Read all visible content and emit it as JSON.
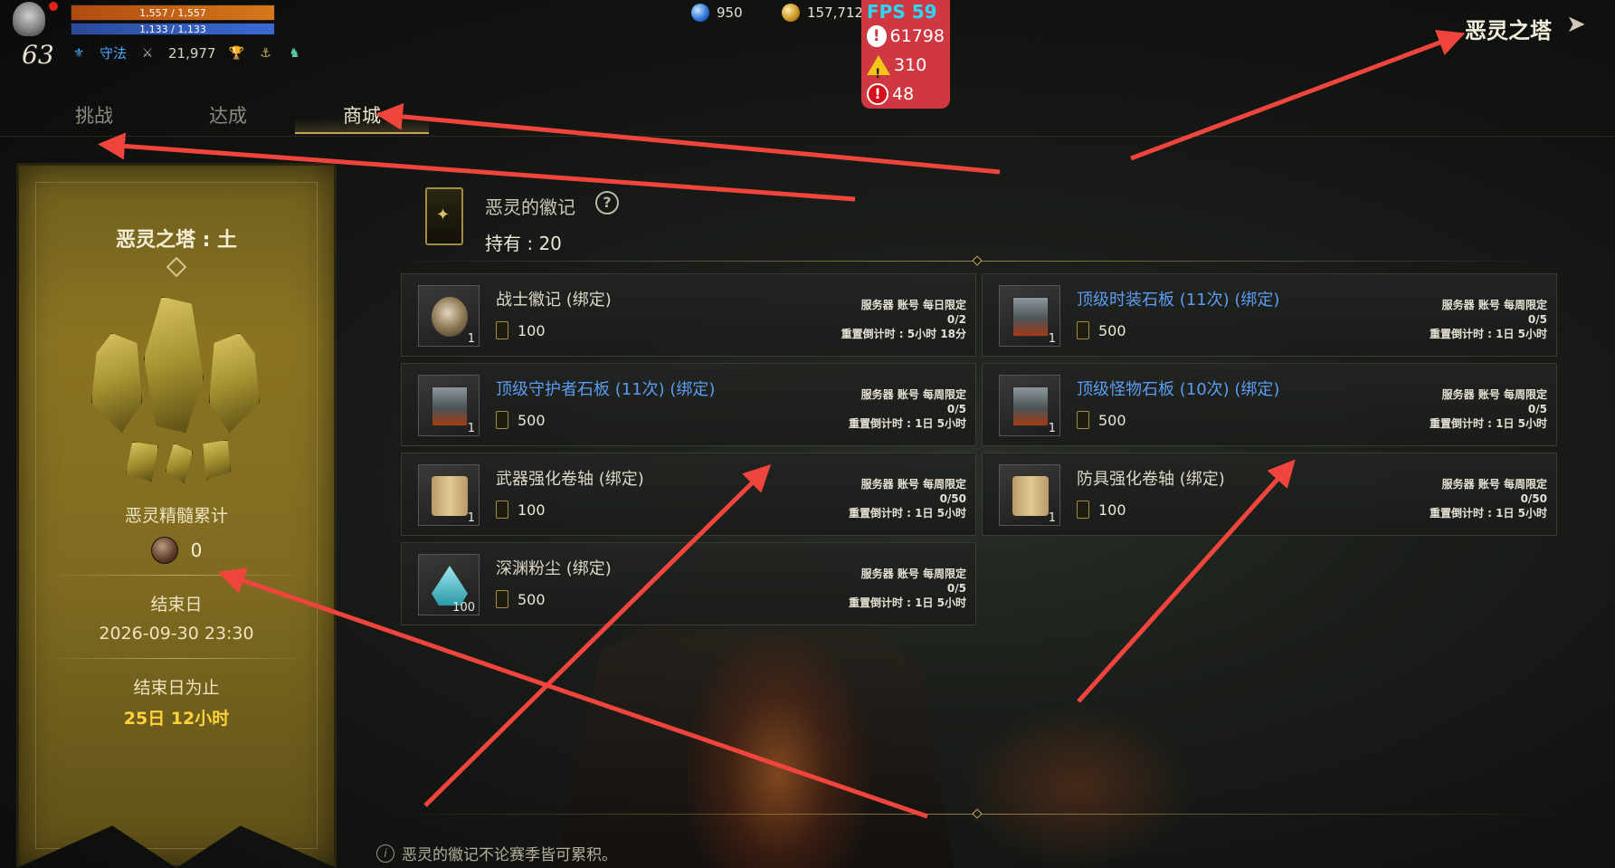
{
  "hud": {
    "level": "63",
    "hp": "1,557 / 1,557",
    "mp": "1,133 / 1,133",
    "class_name": "守法",
    "power": "21,977",
    "gems": "950",
    "gold": "157,712"
  },
  "fps": {
    "title": "FPS 59",
    "info_count": "61798",
    "warn_count": "310",
    "error_count": "48"
  },
  "page_title": "恶灵之塔",
  "tabs": [
    {
      "label": "挑战"
    },
    {
      "label": "达成"
    },
    {
      "label": "商城"
    }
  ],
  "banner": {
    "title": "恶灵之塔 : 土",
    "essence_label": "恶灵精髓累计",
    "essence_value": "0",
    "end_label": "结束日",
    "end_date": "2026-09-30 23:30",
    "until_label": "结束日为止",
    "remaining": "25日 12小时"
  },
  "shop": {
    "currency_name": "恶灵的徽记",
    "owned": "持有 : 20",
    "footer_note": "恶灵的徽记不论赛季皆可累积。",
    "items": [
      {
        "name": "战士徽记 (绑定)",
        "qty": "1",
        "price": "100",
        "limit_line1": "服务器 账号 每日限定",
        "limit_line2": "0/2",
        "limit_line3": "重置倒计时 : 5小时 18分",
        "blue": false
      },
      {
        "name": "顶级时装石板 (11次) (绑定)",
        "qty": "1",
        "price": "500",
        "limit_line1": "服务器 账号 每周限定",
        "limit_line2": "0/5",
        "limit_line3": "重置倒计时 : 1日 5小时",
        "blue": true
      },
      {
        "name": "顶级守护者石板 (11次) (绑定)",
        "qty": "1",
        "price": "500",
        "limit_line1": "服务器 账号 每周限定",
        "limit_line2": "0/5",
        "limit_line3": "重置倒计时 : 1日 5小时",
        "blue": true
      },
      {
        "name": "顶级怪物石板 (10次) (绑定)",
        "qty": "1",
        "price": "500",
        "limit_line1": "服务器 账号 每周限定",
        "limit_line2": "0/5",
        "limit_line3": "重置倒计时 : 1日 5小时",
        "blue": true
      },
      {
        "name": "武器强化卷轴 (绑定)",
        "qty": "1",
        "price": "100",
        "limit_line1": "服务器 账号 每周限定",
        "limit_line2": "0/50",
        "limit_line3": "重置倒计时 : 1日 5小时",
        "blue": false
      },
      {
        "name": "防具强化卷轴 (绑定)",
        "qty": "1",
        "price": "100",
        "limit_line1": "服务器 账号 每周限定",
        "limit_line2": "0/50",
        "limit_line3": "重置倒计时 : 1日 5小时",
        "blue": false
      },
      {
        "name": "深渊粉尘 (绑定)",
        "qty": "100",
        "price": "500",
        "limit_line1": "服务器 账号 每周限定",
        "limit_line2": "0/5",
        "limit_line3": "重置倒计时 : 1日 5小时",
        "blue": false
      }
    ]
  },
  "colors": {
    "accent_gold": "#c9a55a",
    "item_blue": "#5b9cf2",
    "fps_bg": "#cf3841",
    "annotation_red": "#f0453c",
    "remaining_yellow": "#ffd23c"
  }
}
